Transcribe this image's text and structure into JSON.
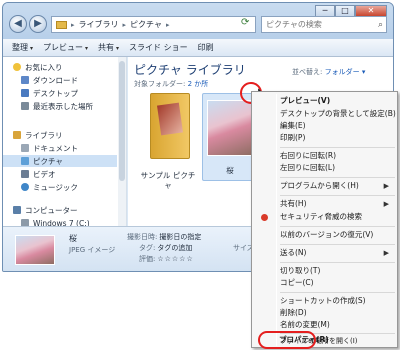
{
  "window": {
    "controls": {
      "minimize": "─",
      "maximize": "□",
      "close": "✕"
    }
  },
  "address": {
    "crumbs": [
      "ライブラリ",
      "ピクチャ"
    ],
    "separator": "▸"
  },
  "search": {
    "placeholder": "ピクチャの検索"
  },
  "toolbar": {
    "items": [
      "整理",
      "プレビュー",
      "共有",
      "スライド ショー",
      "印刷"
    ],
    "dropdown": "▾"
  },
  "nav": {
    "items": [
      {
        "label": "お気に入り",
        "icon": "star-icon",
        "color": "#f0c23b"
      },
      {
        "label": "ダウンロード",
        "icon": "download-folder-icon",
        "color": "#5d87c8"
      },
      {
        "label": "デスクトップ",
        "icon": "desktop-icon",
        "color": "#4a7ac0"
      },
      {
        "label": "最近表示した場所",
        "icon": "recent-places-icon",
        "color": "#7a8a99"
      },
      {
        "label": "ライブラリ",
        "icon": "library-icon",
        "color": "#d8a43a"
      },
      {
        "label": "ドキュメント",
        "icon": "documents-icon",
        "color": "#9aa7b5"
      },
      {
        "label": "ピクチャ",
        "icon": "pictures-icon",
        "color": "#5ea0d8"
      },
      {
        "label": "ビデオ",
        "icon": "videos-icon",
        "color": "#6b7d94"
      },
      {
        "label": "ミュージック",
        "icon": "music-icon",
        "color": "#3f86c8"
      },
      {
        "label": "コンピューター",
        "icon": "computer-icon",
        "color": "#5a7fa8"
      },
      {
        "label": "Windows 7 (C:)",
        "icon": "drive-icon",
        "color": "#8c9aa8"
      }
    ]
  },
  "content": {
    "title": "ピクチャ ライブラリ",
    "sub_prefix": "対象フォルダー: ",
    "sub_link": "2 か所",
    "arrange_prefix": "並べ替え: ",
    "arrange_link": "フォルダー",
    "tiles": [
      {
        "label": "サンプル ピクチャ"
      },
      {
        "label": "桜"
      }
    ]
  },
  "details": {
    "name": "桜",
    "type": "JPEG イメージ",
    "shot_date_label": "撮影日時:",
    "shot_date_value": "撮影日の指定",
    "tag_label": "タグ:",
    "tag_value": "タグの追加",
    "rating_label": "評価:",
    "rating_stars": "☆☆☆☆☆",
    "size_label": "サイズ:"
  },
  "context_menu": {
    "items": [
      {
        "label": "プレビュー(V)",
        "bold": true
      },
      {
        "label": "デスクトップの背景として設定(B)"
      },
      {
        "label": "編集(E)"
      },
      {
        "label": "印刷(P)"
      },
      {
        "sep": true
      },
      {
        "label": "右回りに回転(R)"
      },
      {
        "label": "左回りに回転(L)"
      },
      {
        "sep": true
      },
      {
        "label": "プログラムから開く(H)",
        "submenu": true
      },
      {
        "sep": true
      },
      {
        "label": "共有(H)",
        "submenu": true
      },
      {
        "label": "セキュリティ脅威の検索",
        "icon": "security-scan-icon"
      },
      {
        "sep": true
      },
      {
        "label": "以前のバージョンの復元(V)"
      },
      {
        "sep": true
      },
      {
        "label": "送る(N)",
        "submenu": true
      },
      {
        "sep": true
      },
      {
        "label": "切り取り(T)"
      },
      {
        "label": "コピー(C)"
      },
      {
        "sep": true
      },
      {
        "label": "ショートカットの作成(S)"
      },
      {
        "label": "削除(D)"
      },
      {
        "label": "名前の変更(M)"
      },
      {
        "sep": true
      },
      {
        "label": "ファイルの場所を開く(I)"
      },
      {
        "sep": true
      },
      {
        "label": "プロパティ(R)"
      }
    ],
    "submenu_arrow": "▶"
  },
  "colors": {
    "accent": "#1e3f73",
    "link": "#1a5bb8",
    "highlight": "#e41e1e"
  }
}
